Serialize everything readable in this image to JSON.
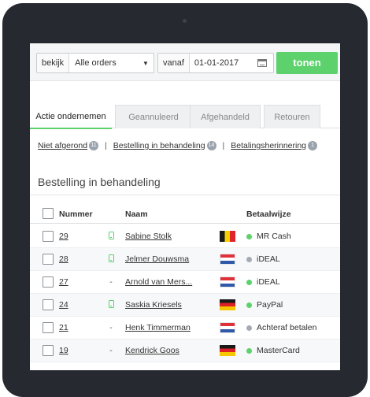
{
  "filters": {
    "view_label": "bekijk",
    "view_value": "Alle orders",
    "from_label": "vanaf",
    "from_value": "01-01-2017",
    "submit_label": "tonen"
  },
  "tabs": [
    {
      "label": "Actie ondernemen",
      "active": true
    },
    {
      "label": "Geannuleerd",
      "active": false
    },
    {
      "label": "Afgehandeld",
      "active": false
    },
    {
      "label": "Retouren",
      "active": false
    }
  ],
  "sublinks": [
    {
      "label": "Niet afgerond",
      "count": "11"
    },
    {
      "label": "Bestelling in behandeling",
      "count": "14"
    },
    {
      "label": "Betalingsherinnering",
      "count": "1"
    }
  ],
  "section_title": "Bestelling in behandeling",
  "table": {
    "headers": {
      "number": "Nummer",
      "name": "Naam",
      "payment": "Betaalwijze"
    },
    "rows": [
      {
        "number": "29",
        "status": "phone-icon",
        "name": "Sabine Stolk",
        "flag": "be",
        "dot": "#5cd16c",
        "payment": "MR Cash"
      },
      {
        "number": "28",
        "status": "phone-icon",
        "name": "Jelmer Douwsma",
        "flag": "nl",
        "dot": "#a5abb2",
        "payment": "iDEAL"
      },
      {
        "number": "27",
        "status": "-",
        "name": "Arnold van Mers...",
        "flag": "nl",
        "dot": "#5cd16c",
        "payment": "iDEAL"
      },
      {
        "number": "24",
        "status": "phone-icon",
        "name": "Saskia Kriesels",
        "flag": "de",
        "dot": "#5cd16c",
        "payment": "PayPal"
      },
      {
        "number": "21",
        "status": "-",
        "name": "Henk Timmerman",
        "flag": "nl",
        "dot": "#a5abb2",
        "payment": "Achteraf betalen"
      },
      {
        "number": "19",
        "status": "-",
        "name": "Kendrick Goos",
        "flag": "de",
        "dot": "#5cd16c",
        "payment": "MasterCard"
      }
    ]
  },
  "colors": {
    "accent": "#5cd16c",
    "device": "#262a30"
  }
}
